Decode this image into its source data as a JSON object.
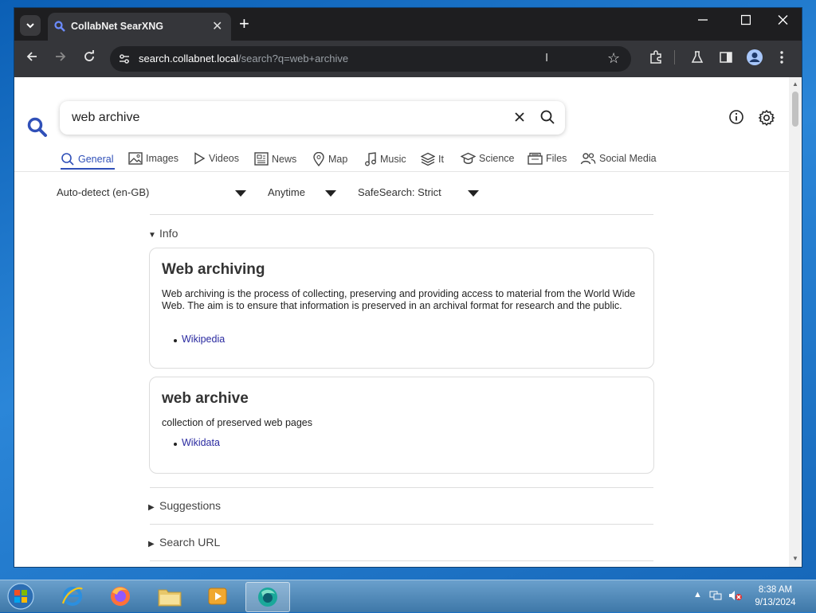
{
  "browser": {
    "tab_title": "CollabNet SearXNG",
    "url_domain": "search.collabnet.local",
    "url_path": "/search?q=web+archive"
  },
  "search": {
    "query": "web archive"
  },
  "categories": [
    "General",
    "Images",
    "Videos",
    "News",
    "Map",
    "Music",
    "It",
    "Science",
    "Files",
    "Social Media"
  ],
  "filters": {
    "language": "Auto-detect (en-GB)",
    "time": "Anytime",
    "safesearch": "SafeSearch: Strict"
  },
  "info_label": "Info",
  "infoboxes": [
    {
      "title": "Web archiving",
      "description": "Web archiving is the process of collecting, preserving and providing access to material from the World Wide Web. The aim is to ensure that information is preserved in an archival format for research and the public.",
      "link": "Wikipedia"
    },
    {
      "title": "web archive",
      "description": "collection of preserved web pages",
      "link": "Wikidata"
    }
  ],
  "sections": {
    "suggestions": "Suggestions",
    "search_url": "Search URL"
  },
  "taskbar": {
    "time": "8:38 AM",
    "date": "9/13/2024"
  }
}
